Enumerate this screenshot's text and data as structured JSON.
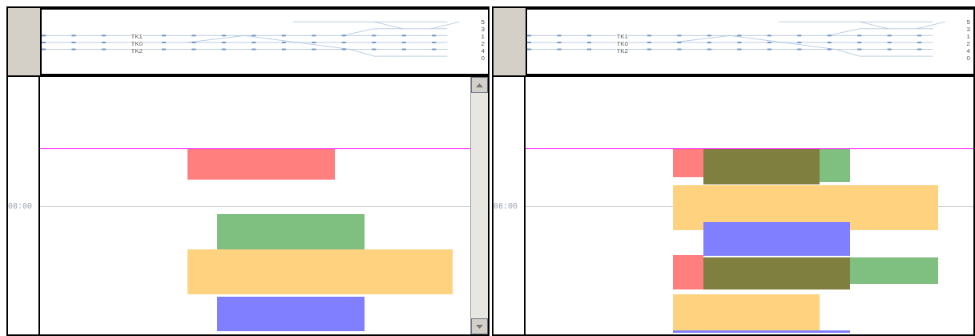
{
  "panes": [
    {
      "overview": {
        "track_labels": [
          "TK1",
          "TK0",
          "TK2"
        ],
        "end_labels": [
          "5",
          "3",
          "1",
          "2",
          "4",
          "0"
        ]
      },
      "time_label": "08:00",
      "scrollbar": true,
      "blocks": [
        {
          "color": "#ff7f7f"
        },
        {
          "color": "#7fbf7f"
        },
        {
          "color": "#ffd27f"
        },
        {
          "color": "#7f7fff"
        }
      ]
    },
    {
      "overview": {
        "track_labels": [
          "TK1",
          "TK0",
          "TK2"
        ],
        "end_labels": [
          "5",
          "3",
          "1",
          "2",
          "4",
          "0"
        ]
      },
      "time_label": "08:00",
      "blocks": [
        {
          "color": "#ff7f7f"
        },
        {
          "color": "#7f7f3f"
        },
        {
          "color": "#7fbf7f"
        },
        {
          "color": "#ffd27f"
        },
        {
          "color": "#7f7fff"
        },
        {
          "color": "#ff7f7f"
        },
        {
          "color": "#7f7f3f"
        },
        {
          "color": "#7fbf7f"
        },
        {
          "color": "#ffd27f"
        },
        {
          "color": "#7f7fff"
        }
      ]
    }
  ]
}
